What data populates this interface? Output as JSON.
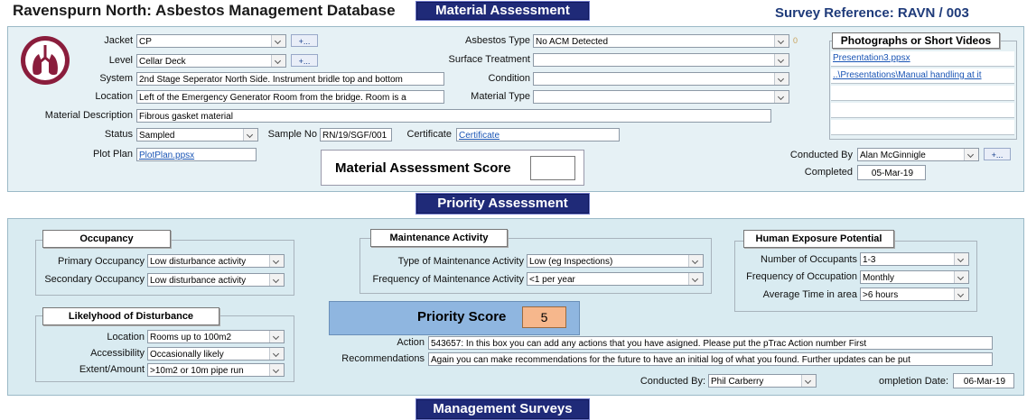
{
  "header": {
    "app_title": "Ravenspurn North: Asbestos Management Database",
    "tab_material": "Material Assessment",
    "survey_ref": "Survey Reference: RAVN / 003",
    "tab_priority": "Priority Assessment",
    "tab_management": "Management Surveys"
  },
  "material": {
    "jacket_label": "Jacket",
    "jacket_value": "CP",
    "level_label": "Level",
    "level_value": "Cellar Deck",
    "system_label": "System",
    "system_value": "2nd Stage Seperator North Side. Instrument bridle top and bottom",
    "location_label": "Location",
    "location_value": "Left of the Emergency Generator Room from the bridge. Room is a",
    "desc_label": "Material Description",
    "desc_value": "Fibrous gasket material",
    "status_label": "Status",
    "status_value": "Sampled",
    "sample_label": "Sample No",
    "sample_value": "RN/19/SGF/001",
    "cert_label": "Certificate",
    "cert_value": "Certificate",
    "plot_label": "Plot Plan",
    "plot_value": "PlotPlan.ppsx",
    "plus_label": "+...",
    "asbestos_type_label": "Asbestos Type",
    "asbestos_type_value": "No ACM Detected",
    "asbestos_type_code": "0",
    "surface_label": "Surface Treatment",
    "surface_value": "",
    "condition_label": "Condition",
    "condition_value": "",
    "material_type_label": "Material Type",
    "material_type_value": "",
    "score_label": "Material Assessment Score",
    "score_value": "",
    "photos_title": "Photographs or Short Videos",
    "photos": [
      "Presentation3.ppsx",
      "..\\Presentations\\Manual handling at it",
      "",
      "",
      ""
    ],
    "conducted_label": "Conducted By",
    "conducted_value": "Alan McGinnigle",
    "completed_label": "Completed",
    "completed_value": "05-Mar-19"
  },
  "priority": {
    "occupancy_title": "Occupancy",
    "primary_label": "Primary Occupancy",
    "primary_value": "Low disturbance activity",
    "secondary_label": "Secondary Occupancy",
    "secondary_value": "Low disturbance activity",
    "maint_title": "Maintenance Activity",
    "maint_type_label": "Type of Maintenance Activity",
    "maint_type_value": "Low (eg Inspections)",
    "maint_freq_label": "Frequency of Maintenance Activity",
    "maint_freq_value": "<1 per year",
    "human_title": "Human Exposure Potential",
    "occupants_label": "Number of Occupants",
    "occupants_value": "1-3",
    "freq_occ_label": "Frequency of Occupation",
    "freq_occ_value": "Monthly",
    "avg_time_label": "Average Time in area",
    "avg_time_value": ">6 hours",
    "likelihood_title": "Likelyhood of Disturbance",
    "loc_label": "Location",
    "loc_value": "Rooms up to 100m2",
    "access_label": "Accessibility",
    "access_value": "Occasionally likely",
    "extent_label": "Extent/Amount",
    "extent_value": ">10m2 or 10m pipe run",
    "score_label": "Priority Score",
    "score_value": "5",
    "action_label": "Action",
    "action_value": "543657: In this box you can add any actions that you have asigned. Please put the pTrac Action number First",
    "rec_label": "Recommendations",
    "rec_value": "Again you can make recommendations for the future to have an initial log of what you found. Further updates can be put",
    "conducted_label": "Conducted By:",
    "conducted_value": "Phil Carberry",
    "completion_label": "ompletion Date:",
    "completion_value": "06-Mar-19"
  },
  "colors": {
    "navy": "#1f2a78",
    "panel": "#e6f1f5",
    "score_orange": "#f6b78c",
    "score_panel": "#8fb6e0"
  },
  "icons": {
    "logo": "lungs-logo-icon",
    "dropdown": "chevron-down-icon"
  }
}
